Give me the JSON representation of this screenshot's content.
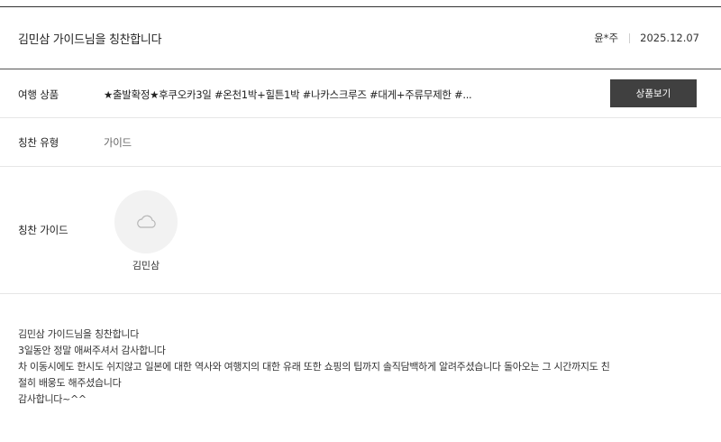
{
  "header": {
    "title": "김민삼 가이드님을 칭찬합니다",
    "author": "윤*주",
    "date": "2025.12.07"
  },
  "product": {
    "label": "여행 상품",
    "value": "★출발확정★후쿠오카3일 #온천1박+힐튼1박 #나카스크루즈 #대게+주류무제한 #...",
    "button_label": "상품보기"
  },
  "praise_type": {
    "label": "칭찬 유형",
    "value": "가이드"
  },
  "praise_guide": {
    "label": "칭찬 가이드",
    "guide_name": "김민삼",
    "avatar_icon": "cloud-icon"
  },
  "review": {
    "lines": [
      "김민삼 가이드님을 칭찬합니다",
      "3일동안 정말 애써주셔서 감사합니다",
      "차 이동시에도 한시도 쉬지않고 일본에 대한 역사와 여행지의 대한 유래 또한 쇼핑의 팁까지 솔직담백하게 알려주셨습니다 돌아오는 그 시간까지도 친",
      "절히 배웅도 해주셨습니다",
      "감사합니다~^^"
    ]
  },
  "colors": {
    "button_bg": "#404040",
    "button_text": "#ffffff",
    "avatar_bg": "#f2f2f2",
    "divider_dark": "#555555",
    "divider_light": "#e6e6e6"
  }
}
